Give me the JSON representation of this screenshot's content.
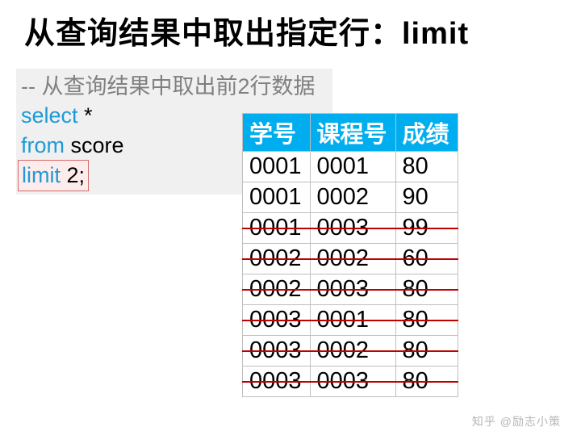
{
  "title": "从查询结果中取出指定行：limit",
  "code": {
    "comment": "-- 从查询结果中取出前2行数据",
    "kw_select": "select",
    "star": " *",
    "kw_from": "from",
    "tbl": " score",
    "kw_limit": "limit",
    "num": " 2;"
  },
  "table": {
    "headers": [
      "学号",
      "课程号",
      "成绩"
    ],
    "rows": [
      {
        "c": [
          "0001",
          "0001",
          "80"
        ],
        "struck": false
      },
      {
        "c": [
          "0001",
          "0002",
          "90"
        ],
        "struck": false
      },
      {
        "c": [
          "0001",
          "0003",
          "99"
        ],
        "struck": true
      },
      {
        "c": [
          "0002",
          "0002",
          "60"
        ],
        "struck": true
      },
      {
        "c": [
          "0002",
          "0003",
          "80"
        ],
        "struck": true
      },
      {
        "c": [
          "0003",
          "0001",
          "80"
        ],
        "struck": true
      },
      {
        "c": [
          "0003",
          "0002",
          "80"
        ],
        "struck": true
      },
      {
        "c": [
          "0003",
          "0003",
          "80"
        ],
        "struck": true
      }
    ]
  },
  "watermark": "知乎 @励志小策"
}
